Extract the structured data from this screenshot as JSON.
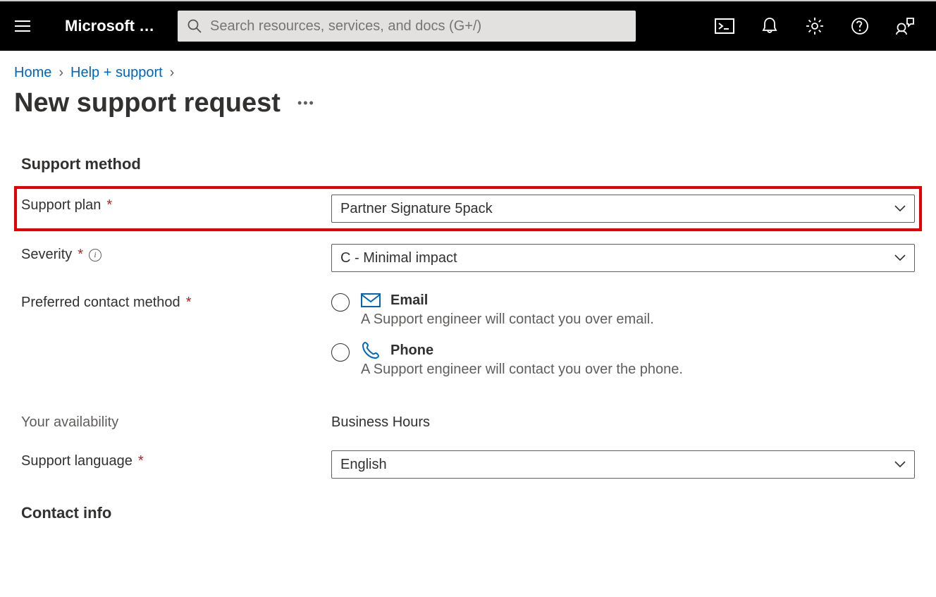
{
  "header": {
    "brand": "Microsoft …",
    "search_placeholder": "Search resources, services, and docs (G+/)"
  },
  "breadcrumbs": {
    "home": "Home",
    "help": "Help + support"
  },
  "page_title": "New support request",
  "sections": {
    "support_method": "Support method",
    "contact_info": "Contact info"
  },
  "form": {
    "support_plan": {
      "label": "Support plan",
      "value": "Partner Signature 5pack"
    },
    "severity": {
      "label": "Severity",
      "value": "C - Minimal impact"
    },
    "contact_method": {
      "label": "Preferred contact method",
      "options": [
        {
          "name": "Email",
          "desc": "A Support engineer will contact you over email."
        },
        {
          "name": "Phone",
          "desc": "A Support engineer will contact you over the phone."
        }
      ]
    },
    "availability": {
      "label": "Your availability",
      "value": "Business Hours"
    },
    "language": {
      "label": "Support language",
      "value": "English"
    }
  }
}
